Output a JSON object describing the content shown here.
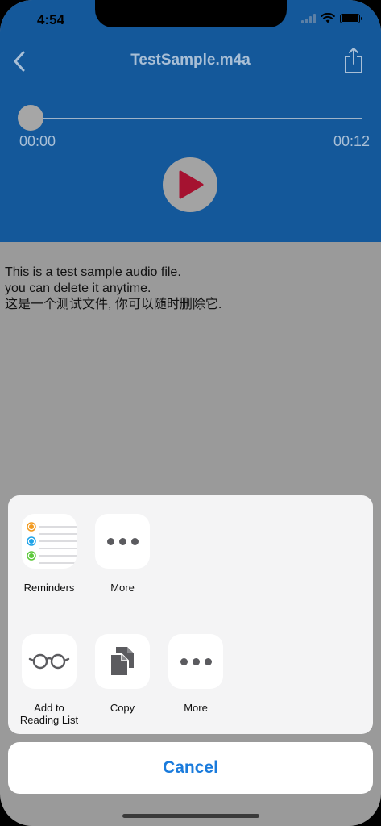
{
  "status_bar": {
    "time": "4:54"
  },
  "nav": {
    "title": "TestSample.m4a"
  },
  "player": {
    "current_time": "00:00",
    "total_time": "00:12",
    "progress": 0
  },
  "content": {
    "lines": [
      "This is a test sample audio file.",
      "you can delete it anytime.",
      "这是一个测试文件, 你可以随时删除它."
    ]
  },
  "share_sheet": {
    "apps": [
      {
        "label": "Reminders",
        "icon": "reminders-icon"
      },
      {
        "label": "More",
        "icon": "more-icon"
      }
    ],
    "actions": [
      {
        "label": "Add to\nReading List",
        "icon": "reading-glasses-icon"
      },
      {
        "label": "Copy",
        "icon": "copy-icon"
      },
      {
        "label": "More",
        "icon": "more-icon"
      }
    ],
    "cancel_label": "Cancel"
  },
  "colors": {
    "header_bg": "#14589a",
    "accent": "#1a7bdc",
    "play_icon": "#a51230"
  }
}
